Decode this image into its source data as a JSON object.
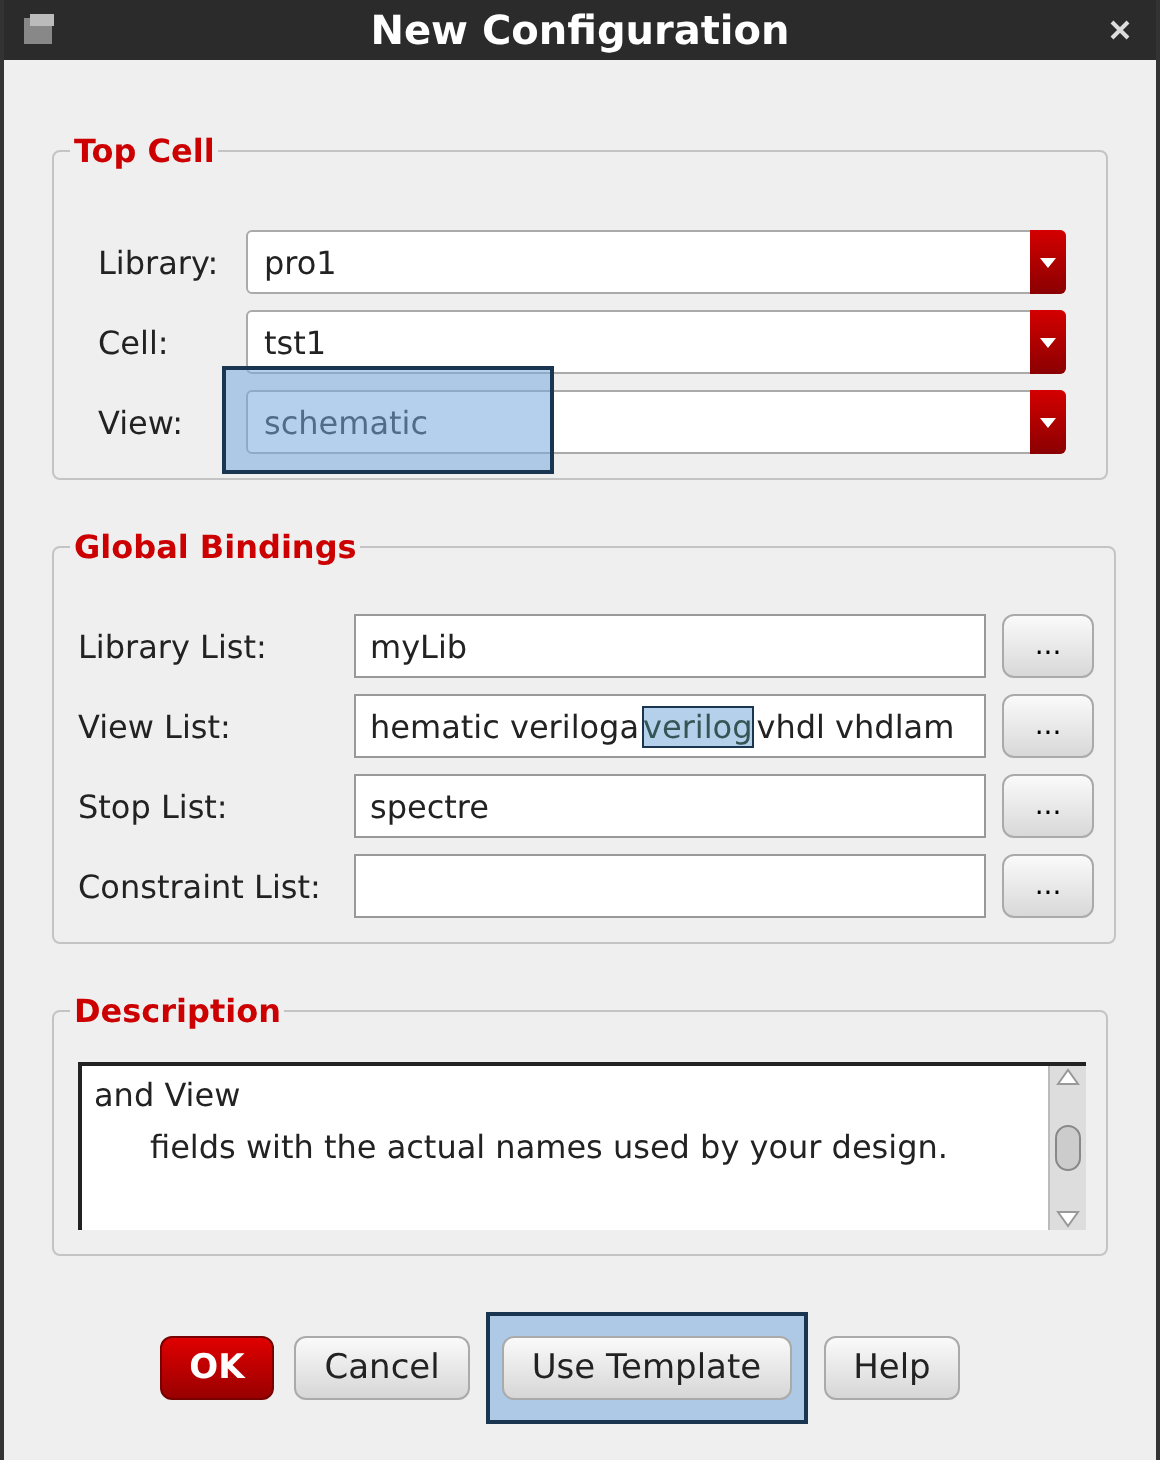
{
  "window": {
    "title": "New Configuration"
  },
  "top_cell": {
    "title": "Top Cell",
    "fields": [
      {
        "label": "Library:",
        "value": "pro1",
        "highlighted": false
      },
      {
        "label": "Cell:",
        "value": "tst1",
        "highlighted": false
      },
      {
        "label": "View:",
        "value": "schematic",
        "highlighted": true
      }
    ]
  },
  "global_bindings": {
    "title": "Global Bindings",
    "fields": [
      {
        "label": "Library List:",
        "segments": [
          {
            "text": "myLib",
            "highlighted": false
          }
        ],
        "button": "..."
      },
      {
        "label": "View List:",
        "segments": [
          {
            "text": "hematic veriloga",
            "highlighted": false
          },
          {
            "text": "verilog",
            "highlighted": true
          },
          {
            "text": "vhdl vhdlam",
            "highlighted": false
          }
        ],
        "button": "..."
      },
      {
        "label": "Stop List:",
        "segments": [
          {
            "text": "spectre",
            "highlighted": false
          }
        ],
        "button": "..."
      },
      {
        "label": "Constraint List:",
        "button": "..."
      }
    ]
  },
  "description": {
    "title": "Description",
    "lines": [
      "and View",
      "fields with the actual names used by your design."
    ]
  },
  "buttons": [
    {
      "label": "OK",
      "kind": "primary",
      "highlighted": false
    },
    {
      "label": "Cancel",
      "kind": "normal",
      "highlighted": false
    },
    {
      "label": "Use Template",
      "kind": "normal",
      "highlighted": true
    },
    {
      "label": "Help",
      "kind": "normal",
      "highlighted": false
    }
  ]
}
